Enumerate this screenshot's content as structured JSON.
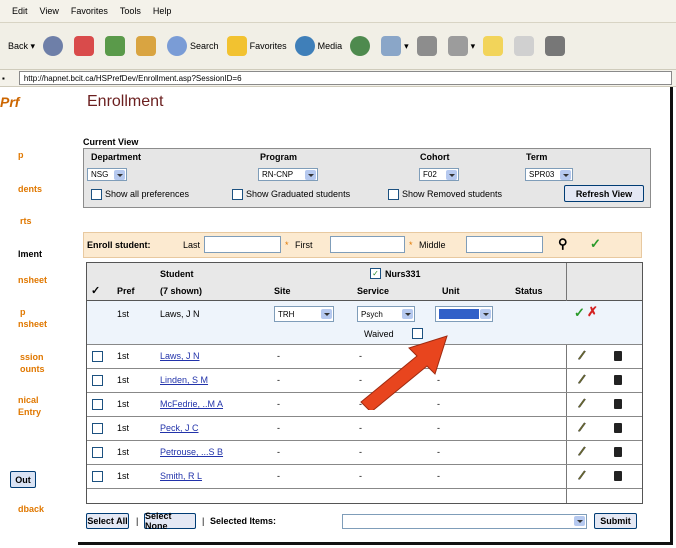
{
  "menu": [
    "Edit",
    "View",
    "Favorites",
    "Tools",
    "Help"
  ],
  "toolbar": {
    "back": "Back",
    "search": "Search",
    "favorites": "Favorites",
    "media": "Media"
  },
  "address": "http://hapnet.bcit.ca/HSPrefDev/Enrollment.asp?SessionID=6",
  "nav": {
    "logo": "Prf",
    "items": [
      "p",
      "dents",
      "rts",
      "lment",
      "nsheet",
      "p",
      "nsheet",
      "ssion",
      "ounts",
      "nical",
      "Entry",
      "Out",
      "dback"
    ]
  },
  "page_title": "Enrollment",
  "current_view": {
    "label": "Current View",
    "department_label": "Department",
    "department_value": "NSG",
    "program_label": "Program",
    "program_value": "RN-CNP",
    "cohort_label": "Cohort",
    "cohort_value": "F02",
    "term_label": "Term",
    "term_value": "SPR03",
    "show_all": "Show all preferences",
    "show_graduated": "Show Graduated students",
    "show_removed": "Show Removed students",
    "refresh": "Refresh View"
  },
  "enroll": {
    "label": "Enroll student:",
    "last": "Last",
    "first": "First",
    "middle": "Middle"
  },
  "table": {
    "headers": {
      "pref": "Pref",
      "student": "Student",
      "student_count": "(7 shown)",
      "site": "Site",
      "service": "Service",
      "unit": "Unit",
      "status": "Status",
      "course": "Nurs331"
    },
    "edit_row": {
      "pref": "1st",
      "student": "Laws, J N",
      "site": "TRH",
      "service": "Psych",
      "waived": "Waived"
    },
    "rows": [
      {
        "pref": "1st",
        "student": "Laws, J N",
        "site": "-",
        "service": "-",
        "unit": "-"
      },
      {
        "pref": "1st",
        "student": "Linden, S M",
        "site": "-",
        "service": "-",
        "unit": "-"
      },
      {
        "pref": "1st",
        "student": "McFedrie, ..M A",
        "site": "-",
        "service": "-",
        "unit": "-"
      },
      {
        "pref": "1st",
        "student": "Peck, J C",
        "site": "-",
        "service": "-",
        "unit": "-"
      },
      {
        "pref": "1st",
        "student": "Petrouse, ...S B",
        "site": "-",
        "service": "-",
        "unit": "-"
      },
      {
        "pref": "1st",
        "student": "Smith, R L",
        "site": "-",
        "service": "-",
        "unit": "-"
      }
    ]
  },
  "bottom": {
    "select_all": "Select All",
    "select_none": "Select None",
    "selected_items": "Selected Items:",
    "submit": "Submit"
  },
  "colors": {
    "accent_orange": "#e07800",
    "title": "#6b1f1f",
    "link": "#2233aa",
    "arrow": "#e8451e"
  }
}
